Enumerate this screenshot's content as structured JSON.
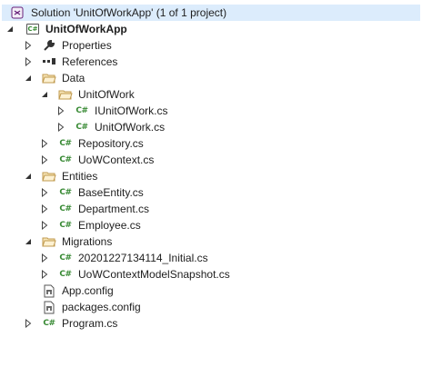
{
  "solution": {
    "label": "Solution 'UnitOfWorkApp' (1 of 1 project)"
  },
  "project": {
    "label": "UnitOfWorkApp",
    "badge": "C#"
  },
  "nodes": {
    "properties": "Properties",
    "references": "References",
    "data": "Data",
    "unitofwork_folder": "UnitOfWork",
    "iunitofwork": "IUnitOfWork.cs",
    "unitofwork_cs": "UnitOfWork.cs",
    "repository": "Repository.cs",
    "uowcontext": "UoWContext.cs",
    "entities": "Entities",
    "baseentity": "BaseEntity.cs",
    "department": "Department.cs",
    "employee": "Employee.cs",
    "migrations": "Migrations",
    "initial": "20201227134114_Initial.cs",
    "snapshot": "UoWContextModelSnapshot.cs",
    "appconfig": "App.config",
    "packagesconfig": "packages.config",
    "program": "Program.cs"
  },
  "icons": {
    "cs_glyph": "C#",
    "cs_color": "#388a34",
    "folder_color": "#dcb67a",
    "solution_color": "#68217a"
  }
}
